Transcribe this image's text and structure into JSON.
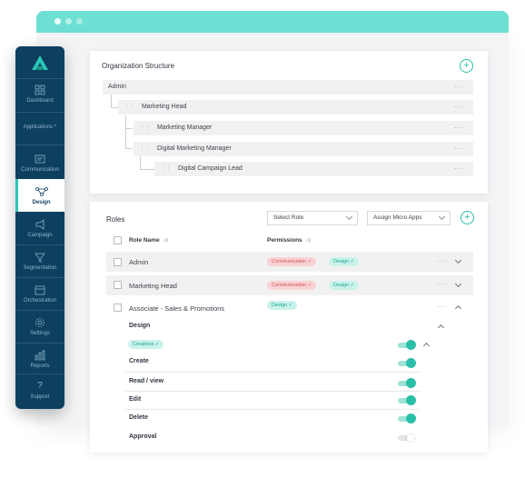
{
  "sidebar": {
    "items": [
      {
        "label": "Dashboard",
        "icon": "grid-icon"
      },
      {
        "label": "Applications",
        "icon": "chevron-up-icon"
      },
      {
        "label": "Communication",
        "icon": "message-box-icon"
      },
      {
        "label": "Design",
        "icon": "design-nodes-icon"
      },
      {
        "label": "Campaign",
        "icon": "megaphone-icon"
      },
      {
        "label": "Segmentation",
        "icon": "funnel-icon"
      },
      {
        "label": "Orchestration",
        "icon": "calendar-icon"
      },
      {
        "label": "Settings",
        "icon": "gear-icon"
      },
      {
        "label": "Reports",
        "icon": "bar-chart-icon"
      },
      {
        "label": "Support",
        "icon": "question-icon"
      }
    ],
    "accent": "#2bc7b4",
    "background": "#0d3f5f"
  },
  "org": {
    "title": "Organization Structure",
    "add_label": "+",
    "nodes": [
      {
        "label": "Admin"
      },
      {
        "label": "Marketing Head"
      },
      {
        "label": "Marketing Manager"
      },
      {
        "label": "Digital Marketing Manager"
      },
      {
        "label": "Digital Campaign Lead"
      }
    ],
    "more_label": "···"
  },
  "roles": {
    "title": "Roles",
    "select_role": "Select Role",
    "assign_apps": "Assign Micro Apps",
    "add_label": "+",
    "col_name": "Role Name",
    "col_permissions": "Permissions",
    "sort_glyph": "↓≡",
    "rows": [
      {
        "name": "Admin",
        "tags": [
          "Communication ✓",
          "Design ✓"
        ]
      },
      {
        "name": "Marketing Head",
        "tags": [
          "Communication ✓",
          "Design ✓"
        ]
      },
      {
        "name": "Associate - Sales & Promotions",
        "tags": [
          "Design ✓"
        ]
      }
    ],
    "expanded": {
      "section": "Design",
      "sub_tag": "Creatives ✓",
      "permissions": [
        {
          "label": "Create",
          "on": true
        },
        {
          "label": "Read / view",
          "on": true
        },
        {
          "label": "Edit",
          "on": true
        },
        {
          "label": "Delete",
          "on": true
        },
        {
          "label": "Approval",
          "on": false
        }
      ]
    },
    "more_label": "···"
  },
  "colors": {
    "window_bar": "#6ee0d3",
    "tag_red_bg": "#f9d2d4",
    "tag_green_bg": "#c9f2ea",
    "toggle_on": "#2bbfa9"
  }
}
